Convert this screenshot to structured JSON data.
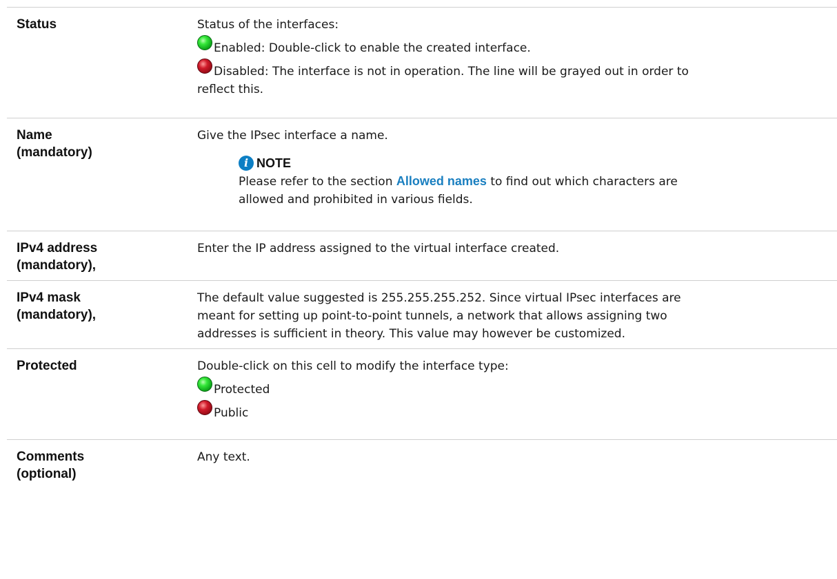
{
  "rows": [
    {
      "label": "Status",
      "intro": "Status of the interfaces:",
      "enabled": "Enabled: Double-click to enable the created interface.",
      "disabled_line1": "Disabled: The interface is not in operation. The line will be grayed out in order to",
      "disabled_line2": "reflect this."
    },
    {
      "label_line1": "Name",
      "label_line2": "(mandatory)",
      "text": "Give the IPsec interface a name.",
      "note": {
        "title": "NOTE",
        "text_before": "Please refer to the section ",
        "link": "Allowed names",
        "text_after": " to find out which characters are",
        "text_line2": "allowed and prohibited in various fields."
      }
    },
    {
      "label_line1": "IPv4 address",
      "label_line2": "(mandatory),",
      "text": "Enter the IP address assigned to the virtual interface created."
    },
    {
      "label_line1": "IPv4 mask",
      "label_line2": "(mandatory),",
      "line1": "The default value suggested is 255.255.255.252. Since virtual IPsec interfaces are",
      "line2": "meant for setting up point-to-point tunnels, a network that allows assigning two",
      "line3": "addresses is sufficient in theory. This value may however be customized."
    },
    {
      "label": "Protected",
      "intro": "Double-click on this cell to modify the interface type:",
      "opt_protected": "Protected",
      "opt_public": "Public"
    },
    {
      "label_line1": "Comments",
      "label_line2": "(optional)",
      "text": "Any text."
    }
  ],
  "colors": {
    "link": "#1a7fc0",
    "note_icon": "#0d7fc4",
    "led_green": "#21c52a",
    "led_red": "#b0101c",
    "border": "#cfcfcf"
  },
  "icons": {
    "enabled": "green-led-icon",
    "disabled": "red-led-icon",
    "note": "info-icon"
  }
}
